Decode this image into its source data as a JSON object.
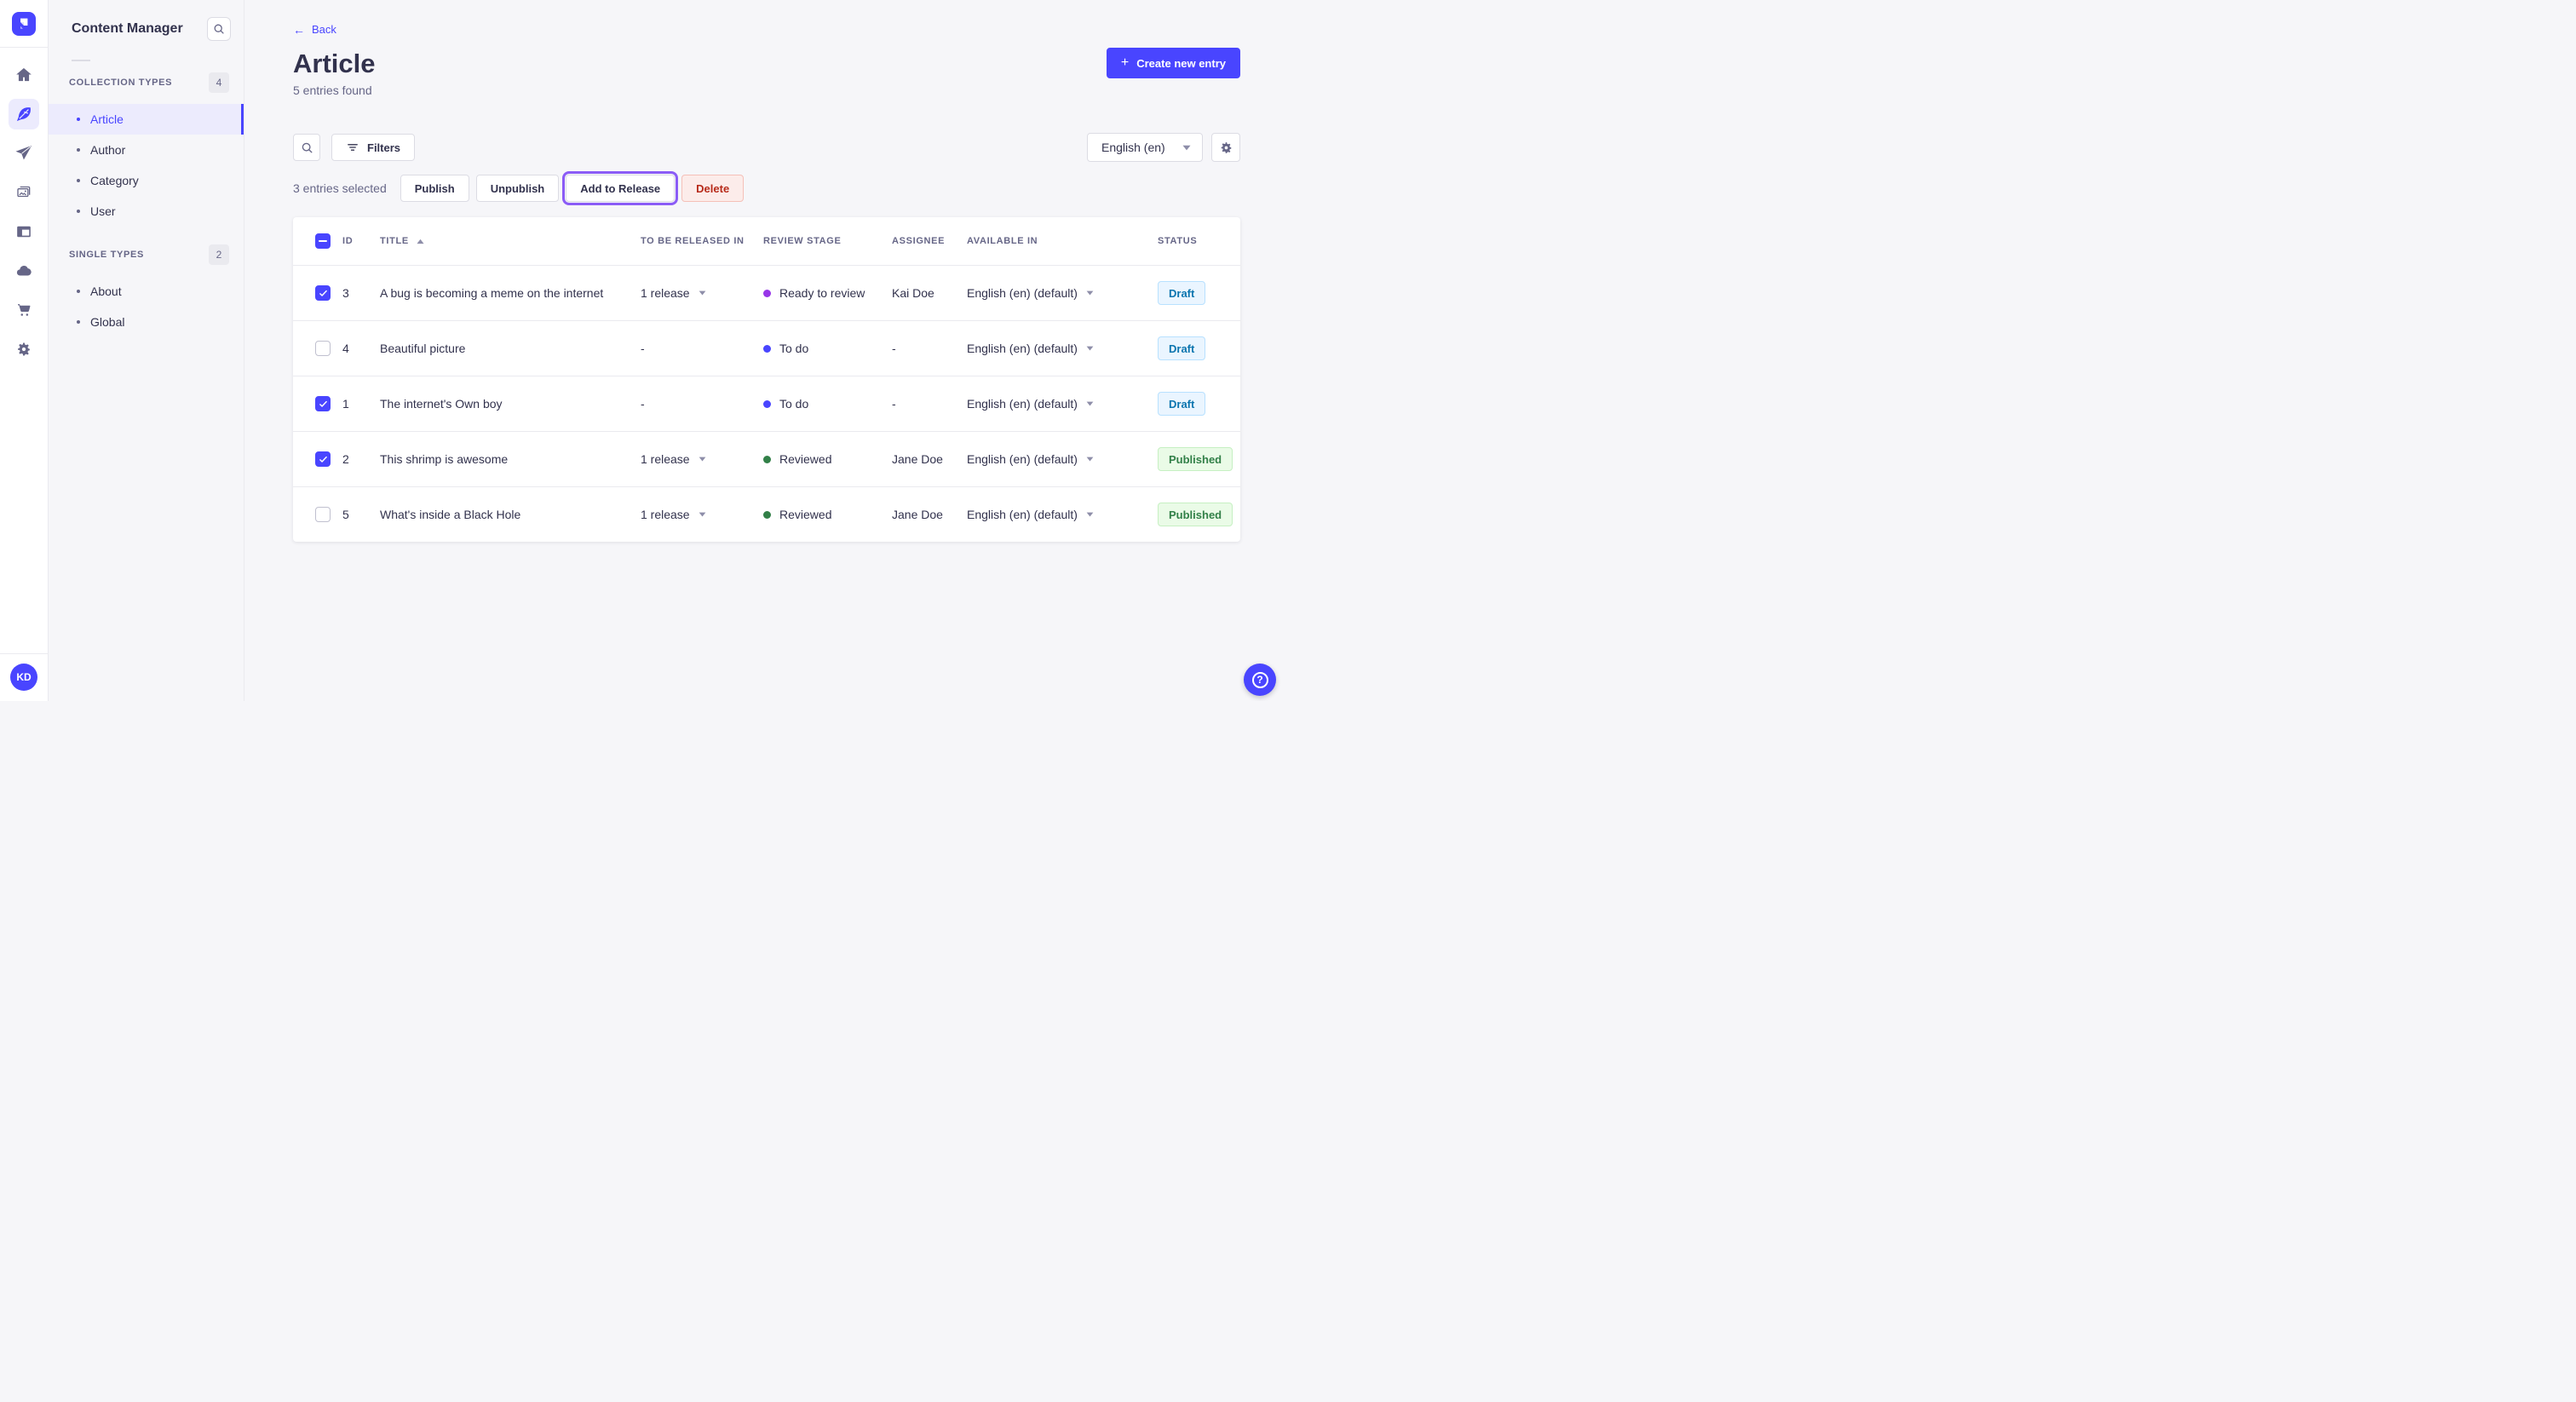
{
  "colors": {
    "primary": "#4945ff",
    "highlight_ring": "#8b5cf6",
    "stage_todo": "#4945ff",
    "stage_ready_to_review": "#9736e8",
    "stage_reviewed": "#328048"
  },
  "nav_rail": {
    "logo_icon": "strapi-logo",
    "items": [
      {
        "name": "home-icon",
        "active": false
      },
      {
        "name": "content-manager-icon",
        "active": true
      },
      {
        "name": "releases-icon",
        "active": false
      },
      {
        "name": "media-library-icon",
        "active": false
      },
      {
        "name": "content-type-builder-icon",
        "active": false
      },
      {
        "name": "deploy-icon",
        "active": false
      },
      {
        "name": "marketplace-icon",
        "active": false
      },
      {
        "name": "settings-icon",
        "active": false
      }
    ],
    "avatar_initials": "KD"
  },
  "subnav": {
    "title": "Content Manager",
    "search_icon": "search-icon",
    "sections": [
      {
        "label": "COLLECTION TYPES",
        "count": "4",
        "items": [
          {
            "label": "Article",
            "active": true
          },
          {
            "label": "Author",
            "active": false
          },
          {
            "label": "Category",
            "active": false
          },
          {
            "label": "User",
            "active": false
          }
        ]
      },
      {
        "label": "SINGLE TYPES",
        "count": "2",
        "items": [
          {
            "label": "About",
            "active": false
          },
          {
            "label": "Global",
            "active": false
          }
        ]
      }
    ]
  },
  "header": {
    "back_label": "Back",
    "back_arrow": "←",
    "title": "Article",
    "subtitle": "5 entries found",
    "create_button": "Create new entry",
    "create_plus": "+"
  },
  "toolbar": {
    "search_icon": "search-icon",
    "filters_label": "Filters",
    "filters_icon": "filter-icon",
    "locale_value": "English (en)",
    "settings_icon": "gear-icon"
  },
  "selection": {
    "count_text": "3 entries selected",
    "publish": "Publish",
    "unpublish": "Unpublish",
    "add_to_release": "Add to Release",
    "delete": "Delete",
    "highlighted_action": "Add to Release"
  },
  "table": {
    "select_all_state": "indeterminate",
    "sort": {
      "column": "TITLE",
      "direction": "asc"
    },
    "headers": {
      "id": "ID",
      "title": "TITLE",
      "released": "TO BE RELEASED IN",
      "review": "REVIEW STAGE",
      "assignee": "ASSIGNEE",
      "available": "AVAILABLE IN",
      "status": "STATUS"
    },
    "rows": [
      {
        "checked": true,
        "id": "3",
        "title": "A bug is becoming a meme on the internet",
        "released": "1 release",
        "released_dropdown": true,
        "stage": "Ready to review",
        "stage_color": "#9736e8",
        "assignee": "Kai Doe",
        "available": "English (en) (default)",
        "status": "Draft"
      },
      {
        "checked": false,
        "id": "4",
        "title": "Beautiful picture",
        "released": "-",
        "released_dropdown": false,
        "stage": "To do",
        "stage_color": "#4945ff",
        "assignee": "-",
        "available": "English (en) (default)",
        "status": "Draft"
      },
      {
        "checked": true,
        "id": "1",
        "title": "The internet's Own boy",
        "released": "-",
        "released_dropdown": false,
        "stage": "To do",
        "stage_color": "#4945ff",
        "assignee": "-",
        "available": "English (en) (default)",
        "status": "Draft"
      },
      {
        "checked": true,
        "id": "2",
        "title": "This shrimp is awesome",
        "released": "1 release",
        "released_dropdown": true,
        "stage": "Reviewed",
        "stage_color": "#328048",
        "assignee": "Jane Doe",
        "available": "English (en) (default)",
        "status": "Published"
      },
      {
        "checked": false,
        "id": "5",
        "title": "What's inside a Black Hole",
        "released": "1 release",
        "released_dropdown": true,
        "stage": "Reviewed",
        "stage_color": "#328048",
        "assignee": "Jane Doe",
        "available": "English (en) (default)",
        "status": "Published"
      }
    ]
  },
  "fab": {
    "help_icon": "question-mark-icon",
    "help_glyph": "?"
  }
}
